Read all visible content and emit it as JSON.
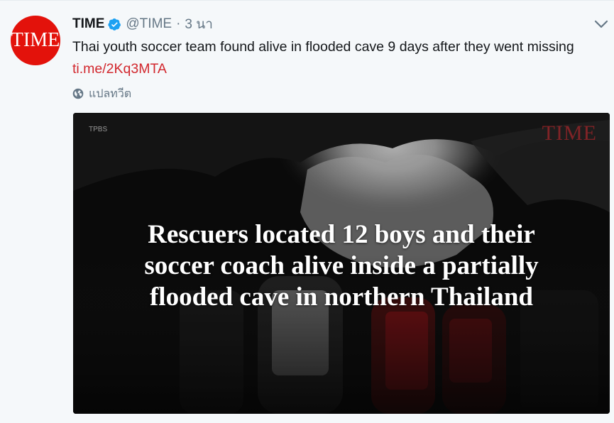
{
  "tweet": {
    "avatar_logo": "TIME",
    "display_name": "TIME",
    "handle": "@TIME",
    "separator": "·",
    "timestamp": "3 นา",
    "text": "Thai youth soccer team found alive in flooded cave 9 days after they went missing",
    "link": "ti.me/2Kq3MTA",
    "translate_label": "แปลทวีต",
    "icons": {
      "verified": "verified-badge-icon",
      "caret": "chevron-down-icon",
      "globe": "globe-icon"
    },
    "colors": {
      "brand": "#e3120b",
      "verified": "#1da1f2",
      "link": "#d2282e",
      "muted": "#657786"
    }
  },
  "media": {
    "caption_lines": [
      "Rescuers located 12 boys and their",
      "soccer coach alive inside a partially",
      "flooded cave in northern Thailand"
    ],
    "watermark_left": "TPBS",
    "watermark_right": "TIME"
  }
}
